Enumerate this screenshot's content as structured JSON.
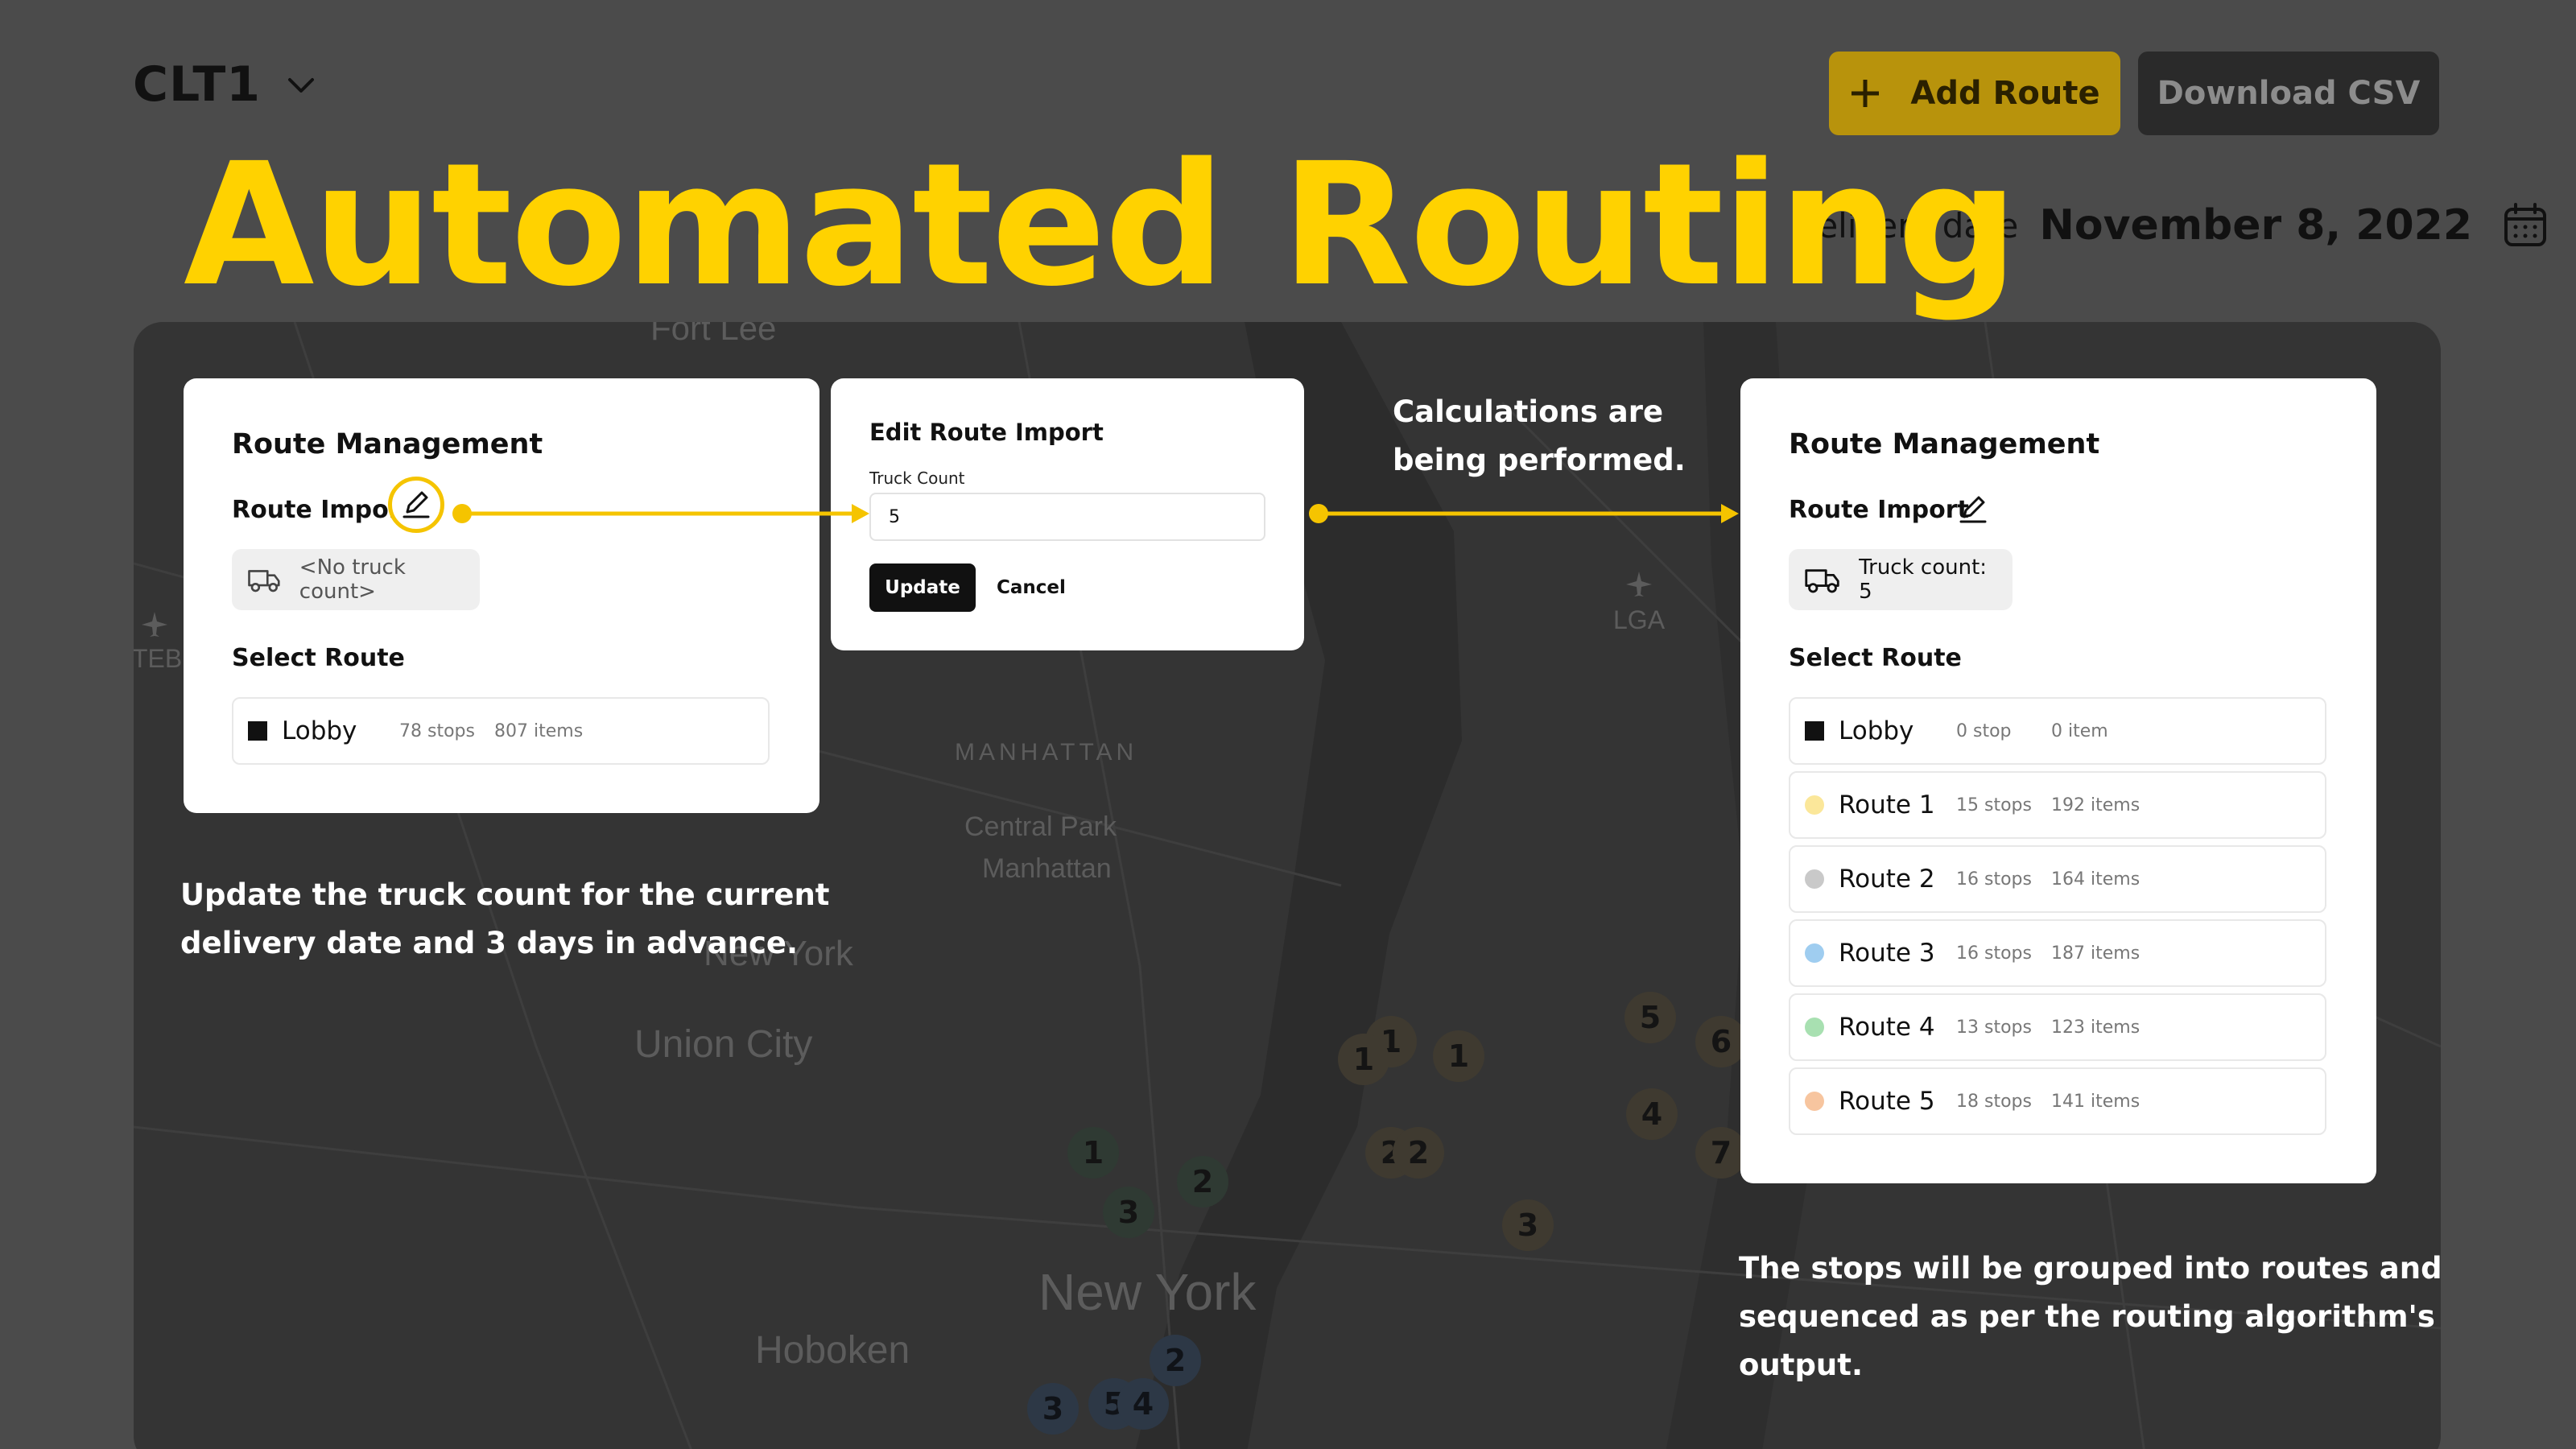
{
  "header": {
    "site_name": "CLT1",
    "add_route_label": "Add Route",
    "download_csv_label": "Download CSV",
    "headline": "Automated Routing",
    "delivery_label": "Delivery date",
    "delivery_date": "November 8, 2022"
  },
  "map_labels": {
    "fort_lee": "Fort Lee",
    "teb": "TEB",
    "lga": "LGA",
    "manhattan": "MANHATTAN",
    "central_park": "Central Park",
    "central_park_sub": "Manhattan",
    "new_york_small": "New York",
    "union_city": "Union City",
    "new_york": "New York",
    "hoboken": "Hoboken"
  },
  "map_pins": [
    "1",
    "2",
    "3",
    "1",
    "2",
    "1",
    "2",
    "3",
    "5",
    "4",
    "1",
    "5",
    "4",
    "6",
    "7",
    "2",
    "3"
  ],
  "left_card": {
    "title": "Route Management",
    "route_import_label": "Route Import",
    "truck_count_text": "<No truck count>",
    "select_route_label": "Select Route",
    "routes": [
      {
        "name": "Lobby",
        "stops": "78 stops",
        "items": "807 items",
        "color": "#111111"
      }
    ]
  },
  "edit_dialog": {
    "title": "Edit Route Import",
    "field_label": "Truck Count",
    "field_value": "5",
    "update_label": "Update",
    "cancel_label": "Cancel"
  },
  "middle_note": {
    "line1": "Calculations are",
    "line2": "being performed."
  },
  "right_card": {
    "title": "Route Management",
    "route_import_label": "Route Import",
    "truck_count_text": "Truck count: 5",
    "select_route_label": "Select Route",
    "routes": [
      {
        "name": "Lobby",
        "stops": "0 stop",
        "items": "0 item",
        "color": "#111111"
      },
      {
        "name": "Route 1",
        "stops": "15 stops",
        "items": "192 items",
        "color": "#fbe79a"
      },
      {
        "name": "Route 2",
        "stops": "16 stops",
        "items": "164 items",
        "color": "#c9c9c9"
      },
      {
        "name": "Route 3",
        "stops": "16 stops",
        "items": "187 items",
        "color": "#9fcdf0"
      },
      {
        "name": "Route 4",
        "stops": "13 stops",
        "items": "123 items",
        "color": "#a8e0b1"
      },
      {
        "name": "Route 5",
        "stops": "18 stops",
        "items": "141 items",
        "color": "#f7c59f"
      }
    ]
  },
  "left_note": {
    "line1": "Update the truck count for the current",
    "line2": "delivery date and 3 days in advance."
  },
  "right_note": {
    "line1": "The stops will be grouped into routes and",
    "line2": "sequenced as per the routing algorithm's",
    "line3": "output."
  },
  "colors": {
    "accent": "#ffd200",
    "background": "#4b4b4b",
    "map": "#343434"
  }
}
